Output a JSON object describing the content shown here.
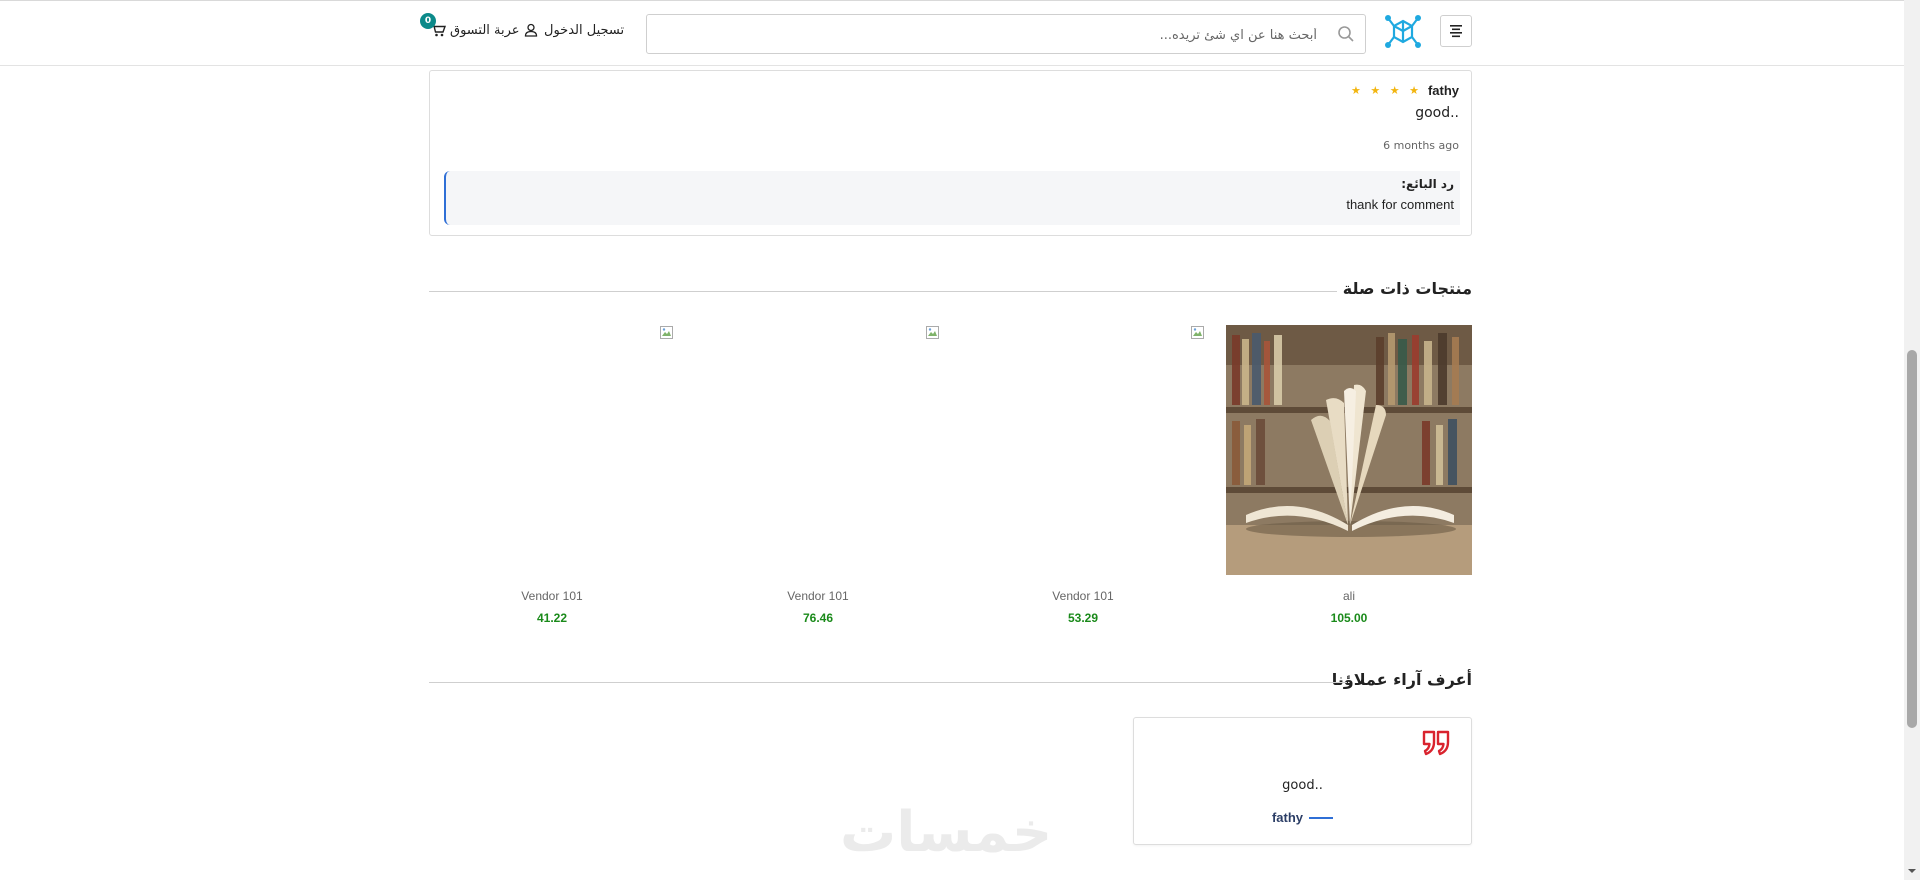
{
  "header": {
    "search_placeholder": "أبحث هنا عن اي شئ تريده...",
    "login_label": "تسجيل الدخول",
    "cart_label": "عربة التسوق",
    "cart_count": "0"
  },
  "review": {
    "name": "fathy",
    "stars": "★ ★ ★ ★",
    "rating": 4,
    "text": "good..",
    "time": "6 months ago",
    "reply_label": "رد البائع:",
    "reply_text": "thank for comment"
  },
  "related": {
    "title": "منتجات ذات صلة",
    "products": [
      {
        "name": "ali",
        "price": "105.00"
      },
      {
        "name": "Vendor 101",
        "price": "53.29"
      },
      {
        "name": "Vendor 101",
        "price": "76.46"
      },
      {
        "name": "Vendor 101",
        "price": "41.22"
      }
    ]
  },
  "testimonials": {
    "title": "أعرف آراء عملاؤنا",
    "items": [
      {
        "text": "good..",
        "author": "fathy"
      }
    ]
  },
  "watermark": "خمسات",
  "colors": {
    "accent_blue": "#2f6fd6",
    "price_green": "#1a8a1a",
    "star_yellow": "#f2b50f",
    "quote_red": "#d9232e",
    "badge_teal": "#0c8a8a",
    "logo_cyan": "#1fa9e0"
  },
  "icons": {
    "menu": "menu-icon",
    "logo": "cube-network-logo",
    "search": "search-icon",
    "user": "user-icon",
    "cart": "cart-icon",
    "quote": "quote-icon"
  }
}
